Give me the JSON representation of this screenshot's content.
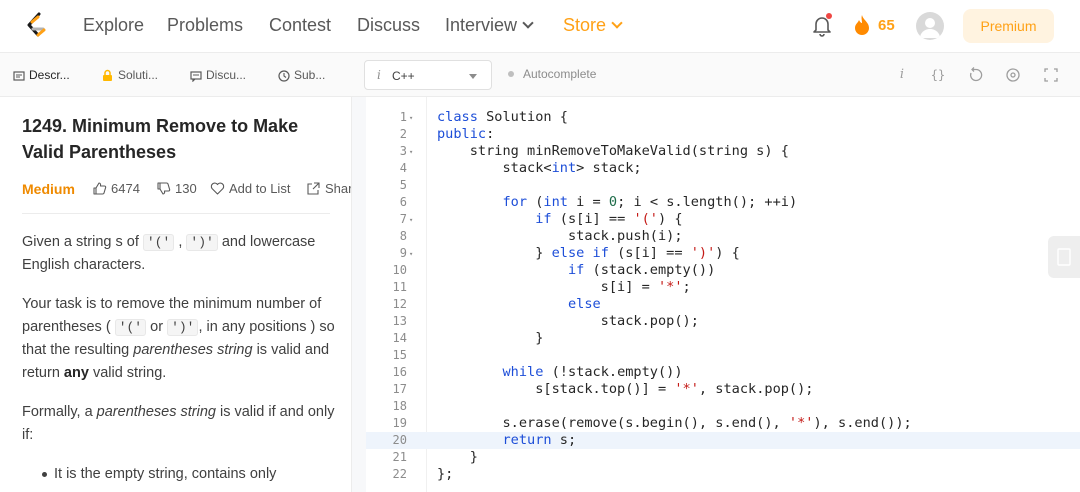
{
  "nav": {
    "items": [
      "Explore",
      "Problems",
      "Contest",
      "Discuss",
      "Interview",
      "Store"
    ],
    "streak_count": "65",
    "premium_label": "Premium"
  },
  "left_tabs": [
    {
      "label": "Descr...",
      "icon": "description-icon"
    },
    {
      "label": "Soluti...",
      "icon": "lock-icon"
    },
    {
      "label": "Discu...",
      "icon": "chat-icon"
    },
    {
      "label": "Sub...",
      "icon": "clock-icon"
    }
  ],
  "problem": {
    "title": "1249. Minimum Remove to Make Valid Parentheses",
    "difficulty": "Medium",
    "likes": "6474",
    "dislikes": "130",
    "add_to_list": "Add to List",
    "share": "Shar",
    "p1": {
      "pre": "Given a string ",
      "s": "s",
      "of": " of ",
      "c1": "'('",
      "comma": " , ",
      "c2": "')'",
      "post": " and lowercase English characters."
    },
    "p2": {
      "a": "Your task is to remove the minimum number of parentheses ( ",
      "c1": "'('",
      "or": " or ",
      "c2": "')'",
      "b": ", in any positions ) so that the resulting ",
      "em": "parentheses string",
      "c": " is valid and return ",
      "bold": "any",
      "d": " valid string."
    },
    "p3": {
      "a": "Formally, a ",
      "em": "parentheses string",
      "b": " is valid if and only if:"
    },
    "bullet1": "It is the empty string, contains only"
  },
  "editor": {
    "language": "C++",
    "autocomplete_label": "Autocomplete",
    "toolbar_icons": [
      "info-icon",
      "braces-icon",
      "reset-icon",
      "settings-icon",
      "fullscreen-icon"
    ],
    "current_line": 20,
    "lines": [
      "class Solution {",
      "public:",
      "    string minRemoveToMakeValid(string s) {",
      "        stack<int> stack;",
      "",
      "        for (int i = 0; i < s.length(); ++i)",
      "            if (s[i] == '(') {",
      "                stack.push(i);",
      "            } else if (s[i] == ')') {",
      "                if (stack.empty())",
      "                    s[i] = '*';",
      "                else",
      "                    stack.pop();",
      "            }",
      "",
      "        while (!stack.empty())",
      "            s[stack.top()] = '*', stack.pop();",
      "",
      "        s.erase(remove(s.begin(), s.end(), '*'), s.end());",
      "        return s;",
      "    }",
      "};"
    ],
    "fold_lines": [
      1,
      3,
      7,
      9
    ]
  }
}
